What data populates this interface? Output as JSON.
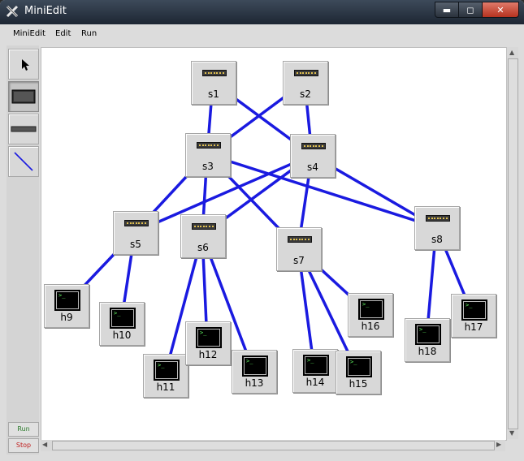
{
  "window": {
    "title": "MiniEdit",
    "buttons": {
      "minimize": "▬",
      "maximize": "◻",
      "close": "✕"
    }
  },
  "menu": [
    "MiniEdit",
    "Edit",
    "Run"
  ],
  "toolbar": {
    "run_label": "Run",
    "stop_label": "Stop",
    "tools": [
      "select-tool",
      "switch-tool",
      "legacy-switch-tool",
      "link-tool"
    ]
  },
  "colors": {
    "link": "#1a1ae0",
    "run": "#2a7a2a",
    "stop": "#c02020"
  },
  "switches": [
    {
      "id": "s1",
      "label": "s1"
    },
    {
      "id": "s2",
      "label": "s2"
    },
    {
      "id": "s3",
      "label": "s3"
    },
    {
      "id": "s4",
      "label": "s4"
    },
    {
      "id": "s5",
      "label": "s5"
    },
    {
      "id": "s6",
      "label": "s6"
    },
    {
      "id": "s7",
      "label": "s7"
    },
    {
      "id": "s8",
      "label": "s8"
    }
  ],
  "hosts": [
    {
      "id": "h9",
      "label": "h9"
    },
    {
      "id": "h10",
      "label": "h10"
    },
    {
      "id": "h11",
      "label": "h11"
    },
    {
      "id": "h12",
      "label": "h12"
    },
    {
      "id": "h13",
      "label": "h13"
    },
    {
      "id": "h14",
      "label": "h14"
    },
    {
      "id": "h15",
      "label": "h15"
    },
    {
      "id": "h16",
      "label": "h16"
    },
    {
      "id": "h17",
      "label": "h17"
    },
    {
      "id": "h18",
      "label": "h18"
    }
  ],
  "links": [
    [
      "s1",
      "s3"
    ],
    [
      "s1",
      "s4"
    ],
    [
      "s2",
      "s3"
    ],
    [
      "s2",
      "s4"
    ],
    [
      "s3",
      "s5"
    ],
    [
      "s3",
      "s6"
    ],
    [
      "s3",
      "s7"
    ],
    [
      "s3",
      "s8"
    ],
    [
      "s4",
      "s5"
    ],
    [
      "s4",
      "s6"
    ],
    [
      "s4",
      "s7"
    ],
    [
      "s4",
      "s8"
    ],
    [
      "s5",
      "h9"
    ],
    [
      "s5",
      "h10"
    ],
    [
      "s6",
      "h11"
    ],
    [
      "s6",
      "h12"
    ],
    [
      "s6",
      "h13"
    ],
    [
      "s7",
      "h14"
    ],
    [
      "s7",
      "h15"
    ],
    [
      "s7",
      "h16"
    ],
    [
      "s8",
      "h17"
    ],
    [
      "s8",
      "h18"
    ]
  ]
}
